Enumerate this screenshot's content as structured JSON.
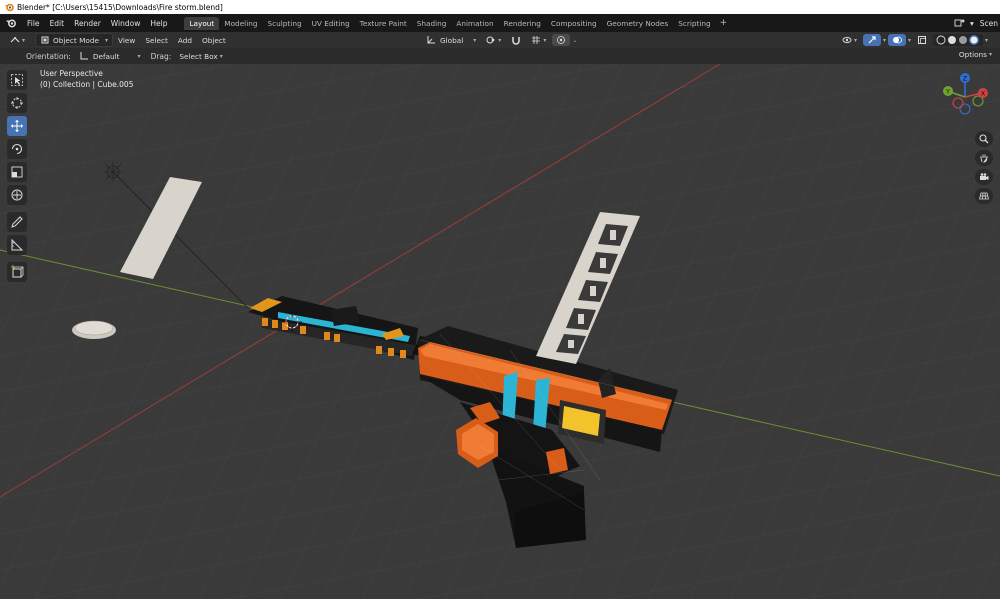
{
  "title_bar": {
    "title": "Blender* [C:\\Users\\15415\\Downloads\\Fire storm.blend]"
  },
  "menu": [
    "File",
    "Edit",
    "Render",
    "Window",
    "Help"
  ],
  "workspace_tabs": [
    "Layout",
    "Modeling",
    "Sculpting",
    "UV Editing",
    "Texture Paint",
    "Shading",
    "Animation",
    "Rendering",
    "Compositing",
    "Geometry Nodes",
    "Scripting"
  ],
  "active_tab": "Layout",
  "scene_label": "Scen",
  "header": {
    "mode": "Object Mode",
    "menus": [
      "View",
      "Select",
      "Add",
      "Object"
    ],
    "transform_orientation": "Global"
  },
  "tool_settings": {
    "orientation_label": "Orientation:",
    "orientation_value": "Default",
    "drag_label": "Drag:",
    "drag_value": "Select Box",
    "options_label": "Options"
  },
  "viewport": {
    "perspective": "User Perspective",
    "collection_info": "(0) Collection | Cube.005"
  },
  "gizmo": {
    "x_label": "X",
    "y_label": "Y",
    "z_label": "Z"
  },
  "colors": {
    "accent_blue": "#4772b3",
    "grid_bg": "#3a3a3a",
    "x_axis": "#c44a4a",
    "y_axis": "#7aa93a",
    "orange": "#e0661c",
    "cyan": "#2bb4d4"
  }
}
